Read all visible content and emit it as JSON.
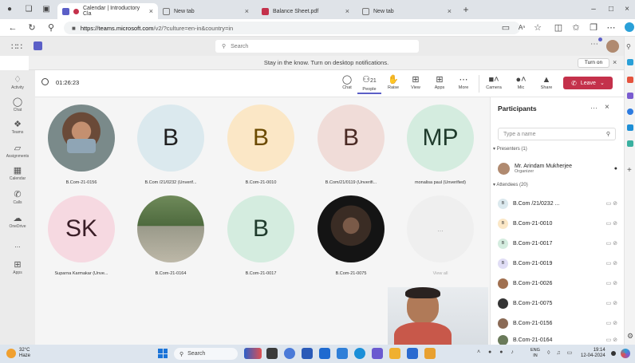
{
  "colors": {
    "teams_purple": "#5b5fc7",
    "leave_red": "#c4314b",
    "accent_blue": "#0f6cbd"
  },
  "browser": {
    "tabs": [
      {
        "label": "Calendar | Introductory Cla",
        "active": true,
        "favicon_color": "#5b5fc7"
      },
      {
        "label": "New tab",
        "active": false,
        "favicon_color": "#777777"
      },
      {
        "label": "Balance Sheet.pdf",
        "active": false,
        "favicon_color": "#c4314b"
      },
      {
        "label": "New tab",
        "active": false,
        "favicon_color": "#777777"
      }
    ],
    "url_host": "https://teams.microsoft.com",
    "url_path": "/v2/?culture=en-in&country=in"
  },
  "teams": {
    "search_placeholder": "Search",
    "notification": "Stay in the know. Turn on desktop notifications.",
    "turn_on_label": "Turn on",
    "rail": [
      "Activity",
      "Chat",
      "Teams",
      "Assignments",
      "Calendar",
      "Calls",
      "OneDrive",
      "...",
      "Apps"
    ],
    "timer": "01:26:23",
    "toolbar": {
      "chat": "Chat",
      "people": "People",
      "people_count": "21",
      "raise": "Raise",
      "view": "View",
      "apps": "Apps",
      "more": "More",
      "camera": "Camera",
      "mic": "Mic",
      "share": "Share",
      "leave": "Leave"
    }
  },
  "tiles_row1": [
    {
      "name": "B.Com-21-0156",
      "initials": "",
      "bg": "photo",
      "fg": "#1f1f1f"
    },
    {
      "name": "B.Com /21/0232 (Unverif...",
      "initials": "B",
      "bg": "#dbe9ee",
      "fg": "#1f1f1f"
    },
    {
      "name": "B.Com-21-0010",
      "initials": "B",
      "bg": "#fbe7c6",
      "fg": "#6b4a00"
    },
    {
      "name": "B.Com/21/0119 (Unverifi...",
      "initials": "B",
      "bg": "#f0dcd8",
      "fg": "#4a2a24"
    },
    {
      "name": "monalisa paul (Unverified)",
      "initials": "MP",
      "bg": "#d4ecdf",
      "fg": "#1f3b2c"
    }
  ],
  "tiles_row2": [
    {
      "name": "Suparna Karmakar (Unve...",
      "initials": "SK",
      "bg": "#f6d9e1",
      "fg": "#3a1e27"
    },
    {
      "name": "B.Com-21-0164",
      "initials": "",
      "bg": "photo",
      "fg": "#1f1f1f"
    },
    {
      "name": "B.Com-21-0017",
      "initials": "B",
      "bg": "#d4ecdf",
      "fg": "#1f3b2c"
    },
    {
      "name": "B.Com-21-0075",
      "initials": "",
      "bg": "photo",
      "fg": "#1f1f1f"
    },
    {
      "name": "View all",
      "initials": "...",
      "bg": "#efefef",
      "fg": "#aaaaaa"
    }
  ],
  "participants": {
    "title": "Participants",
    "invite_placeholder": "Type a name",
    "presenters_label": "Presenters (1)",
    "attendees_label": "Attendees (20)",
    "organizer": {
      "name": "Mr. Arindam Mukherjee",
      "role": "Organizer"
    },
    "attendees": [
      {
        "name": "B.Com /21/0232 ...",
        "initial": "B",
        "bg": "#dbe9ee"
      },
      {
        "name": "B.Com-21-0010",
        "initial": "B",
        "bg": "#fbe7c6"
      },
      {
        "name": "B.Com-21-0017",
        "initial": "B",
        "bg": "#d4ecdf"
      },
      {
        "name": "B.Com-21-0019",
        "initial": "B",
        "bg": "#e0ddf5"
      },
      {
        "name": "B.Com-21-0026",
        "initial": "",
        "bg": "#a07050"
      },
      {
        "name": "B.Com-21-0075",
        "initial": "",
        "bg": "#333333"
      },
      {
        "name": "B.Com-21-0156",
        "initial": "",
        "bg": "#8a6a55"
      },
      {
        "name": "B.Com-21-0164",
        "initial": "",
        "bg": "#6a7a5a"
      }
    ]
  },
  "taskbar": {
    "temp": "32°C",
    "weather": "Haze",
    "search": "Search",
    "lang1": "ENG",
    "lang2": "IN",
    "time": "19:14",
    "date": "12-04-2024"
  }
}
